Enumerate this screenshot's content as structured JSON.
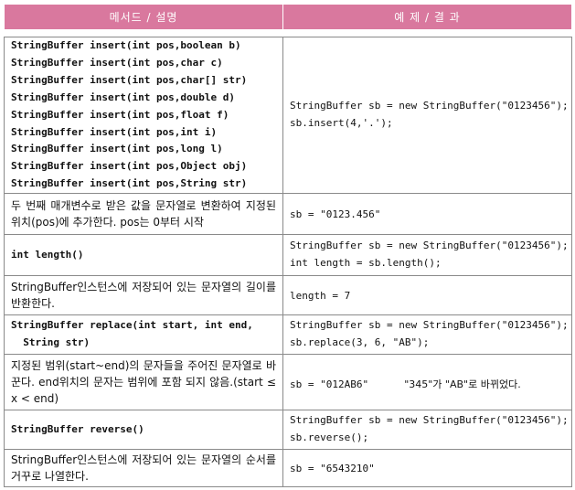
{
  "header": {
    "col1": "메서드 / 설명",
    "col2": "예 제 / 결 과"
  },
  "rows": [
    {
      "signature": [
        "StringBuffer insert(int pos,boolean b)",
        "StringBuffer insert(int pos,char c)",
        "StringBuffer insert(int pos,char[] str)",
        "StringBuffer insert(int pos,double d)",
        "StringBuffer insert(int pos,float f)",
        "StringBuffer insert(int pos,int i)",
        "StringBuffer insert(int pos,long l)",
        "StringBuffer insert(int pos,Object obj)",
        "StringBuffer insert(int pos,String str)"
      ],
      "example": [
        "StringBuffer sb = new StringBuffer(\"0123456\");",
        "sb.insert(4,'.');"
      ],
      "description": "두 번째 매개변수로 받은 값을 문자열로 변환하여 지정된 위치(pos)에 추가한다. pos는 0부터 시작",
      "result": "sb = \"0123.456\""
    },
    {
      "signature": [
        "int length()"
      ],
      "example": [
        "StringBuffer sb = new StringBuffer(\"0123456\");",
        "int length = sb.length();"
      ],
      "description": "StringBuffer인스턴스에 저장되어 있는 문자열의 길이를 반환한다.",
      "result": "length = 7"
    },
    {
      "signature": [
        "StringBuffer replace(int start, int end,",
        "  String str)"
      ],
      "example": [
        "StringBuffer sb = new StringBuffer(\"0123456\");",
        "sb.replace(3, 6, \"AB\");"
      ],
      "description": "지정된 범위(start~end)의 문자들을 주어진 문자열로 바꾼다. end위치의 문자는 범위에 포함 되지 않음.(start ≤ x < end)",
      "result": "sb = \"012AB6\"",
      "result_note": "\"345\"가 \"AB\"로 바뀌었다."
    },
    {
      "signature": [
        "StringBuffer reverse()"
      ],
      "example": [
        "StringBuffer sb = new StringBuffer(\"0123456\");",
        "sb.reverse();"
      ],
      "description": "StringBuffer인스턴스에 저장되어 있는 문자열의 순서를 거꾸로 나열한다.",
      "result": "sb = \"6543210\""
    }
  ]
}
